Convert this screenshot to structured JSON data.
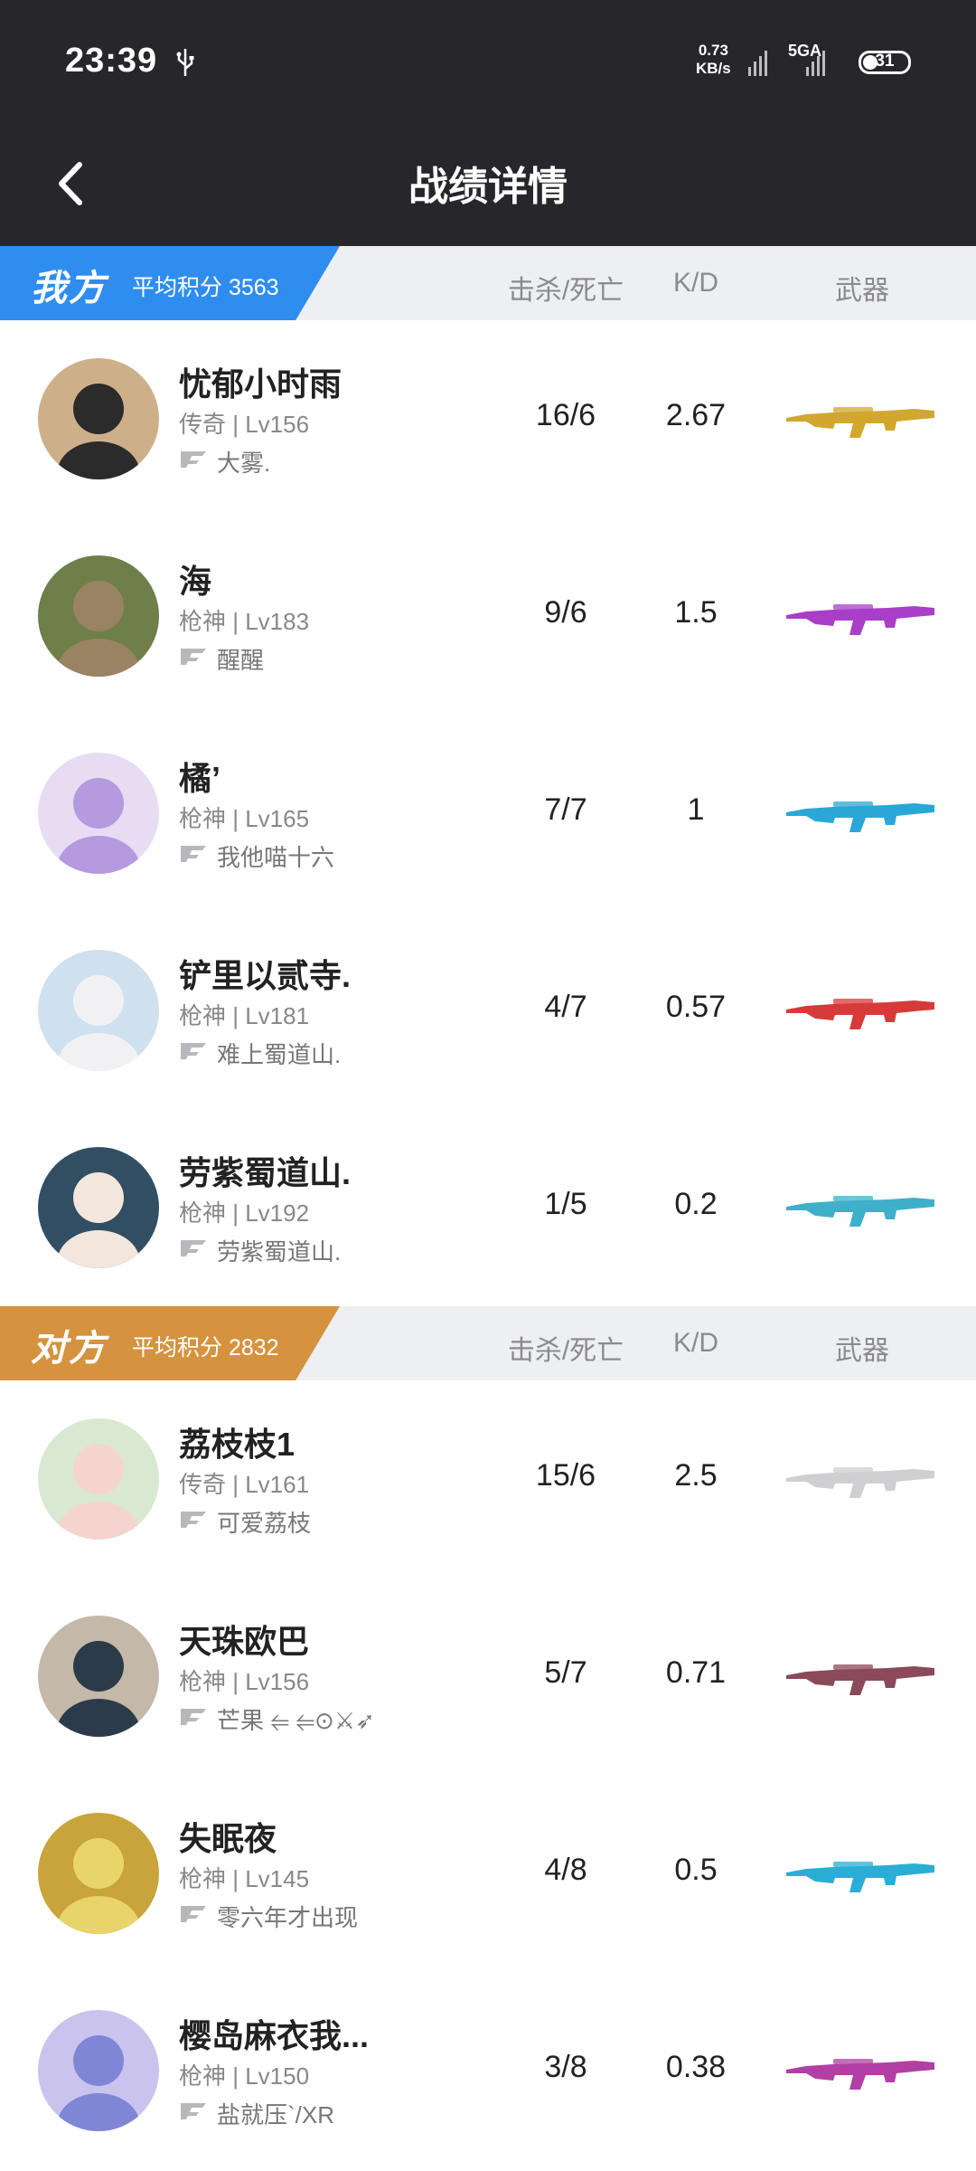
{
  "status_bar": {
    "time": "23:39",
    "speed_value": "0.73",
    "speed_unit": "KB/s",
    "network": "5GA",
    "battery": "31"
  },
  "nav": {
    "title": "战绩详情",
    "back_icon": "chevron-left-icon"
  },
  "columns": {
    "kd": "击杀/死亡",
    "ratio": "K/D",
    "weapon": "武器"
  },
  "teams": [
    {
      "name": "我方",
      "avg_label": "平均积分 3563",
      "color": "#2f8df0",
      "players": [
        {
          "name": "忧郁小时雨",
          "level": "传奇 | Lv156",
          "clan": "大雾.",
          "kd": "16/6",
          "ratio": "2.67",
          "weapon_color": "#d1a72e",
          "avatar_bg": "#cdb08a",
          "avatar_fg": "#2b2b2b"
        },
        {
          "name": "海",
          "level": "枪神 | Lv183",
          "clan": "醒醒",
          "kd": "9/6",
          "ratio": "1.5",
          "weapon_color": "#a93fc9",
          "avatar_bg": "#6f7f49",
          "avatar_fg": "#9a8363"
        },
        {
          "name": "橘’",
          "level": "枪神 | Lv165",
          "clan": "我他喵十六",
          "kd": "7/7",
          "ratio": "1",
          "weapon_color": "#2aa7d6",
          "avatar_bg": "#e8dcf3",
          "avatar_fg": "#b59ae0"
        },
        {
          "name": "铲里以贰寺.",
          "level": "枪神 | Lv181",
          "clan": "难上蜀道山.",
          "kd": "4/7",
          "ratio": "0.57",
          "weapon_color": "#d83a3a",
          "avatar_bg": "#cfe0ee",
          "avatar_fg": "#f1f1f4"
        },
        {
          "name": "劳紫蜀道山.",
          "level": "枪神 | Lv192",
          "clan": "劳紫蜀道山.",
          "kd": "1/5",
          "ratio": "0.2",
          "weapon_color": "#3fb0c9",
          "avatar_bg": "#324e62",
          "avatar_fg": "#f3e6dc"
        }
      ]
    },
    {
      "name": "对方",
      "avg_label": "平均积分 2832",
      "color": "#d5923f",
      "players": [
        {
          "name": "荔枝枝1",
          "level": "传奇 | Lv161",
          "clan": "可爱荔枝",
          "kd": "15/6",
          "ratio": "2.5",
          "weapon_color": "#cfcfd2",
          "avatar_bg": "#d9e8d0",
          "avatar_fg": "#f5d4d0"
        },
        {
          "name": "天珠欧巴",
          "level": "枪神 | Lv156",
          "clan": "芒果 ⥢ ⥢⊙⚔➶",
          "kd": "5/7",
          "ratio": "0.71",
          "weapon_color": "#8a4a5a",
          "avatar_bg": "#c4b8a8",
          "avatar_fg": "#2c3b4a"
        },
        {
          "name": "失眠夜",
          "level": "枪神 | Lv145",
          "clan": "零六年才出现",
          "kd": "4/8",
          "ratio": "0.5",
          "weapon_color": "#2aaed6",
          "avatar_bg": "#c9a43a",
          "avatar_fg": "#e8d46a"
        },
        {
          "name": "樱岛麻衣我...",
          "level": "枪神 | Lv150",
          "clan": "盐就压`/XR",
          "kd": "3/8",
          "ratio": "0.38",
          "weapon_color": "#b23fa4",
          "avatar_bg": "#c9c3ee",
          "avatar_fg": "#7f86d6"
        }
      ]
    }
  ]
}
